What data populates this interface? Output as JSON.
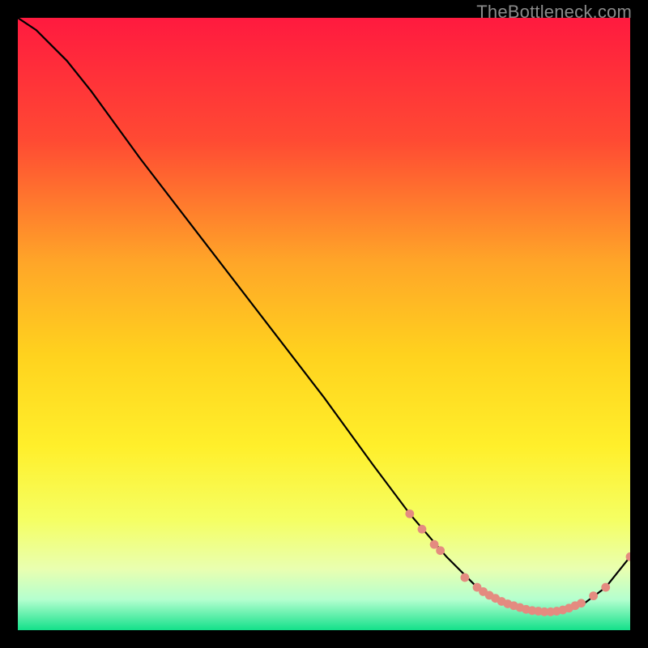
{
  "watermark": "TheBottleneck.com",
  "chart_data": {
    "type": "line",
    "title": "",
    "xlabel": "",
    "ylabel": "",
    "xlim": [
      0,
      100
    ],
    "ylim": [
      0,
      100
    ],
    "grid": false,
    "legend": false,
    "gradient_stops": [
      {
        "offset": 0,
        "color": "#ff1a3f"
      },
      {
        "offset": 20,
        "color": "#ff4a33"
      },
      {
        "offset": 40,
        "color": "#ffa628"
      },
      {
        "offset": 55,
        "color": "#ffd21e"
      },
      {
        "offset": 70,
        "color": "#ffef2b"
      },
      {
        "offset": 82,
        "color": "#f5ff63"
      },
      {
        "offset": 90,
        "color": "#e9ffb0"
      },
      {
        "offset": 95,
        "color": "#b4ffcf"
      },
      {
        "offset": 100,
        "color": "#13e08a"
      }
    ],
    "series": [
      {
        "name": "curve",
        "x": [
          0,
          3,
          6,
          8,
          12,
          20,
          30,
          40,
          50,
          58,
          64,
          70,
          75,
          80,
          84,
          88,
          92,
          96,
          100
        ],
        "y": [
          100,
          98,
          95,
          93,
          88,
          77,
          64,
          51,
          38,
          27,
          19,
          12,
          7,
          4,
          3,
          3,
          4,
          7,
          12
        ]
      }
    ],
    "markers": {
      "name": "highlight-band",
      "color": "#e48b80",
      "radius": 5.4,
      "x": [
        64,
        66,
        68,
        69,
        73,
        75,
        76,
        77,
        78,
        79,
        80,
        81,
        82,
        83,
        84,
        85,
        86,
        87,
        88,
        89,
        90,
        91,
        92,
        94,
        96,
        100
      ],
      "y": [
        19,
        16.5,
        14,
        13,
        8.6,
        7,
        6.3,
        5.7,
        5.2,
        4.7,
        4.3,
        4.0,
        3.7,
        3.4,
        3.2,
        3.1,
        3.0,
        3.0,
        3.1,
        3.3,
        3.6,
        4.0,
        4.4,
        5.6,
        7.0,
        12
      ]
    }
  }
}
